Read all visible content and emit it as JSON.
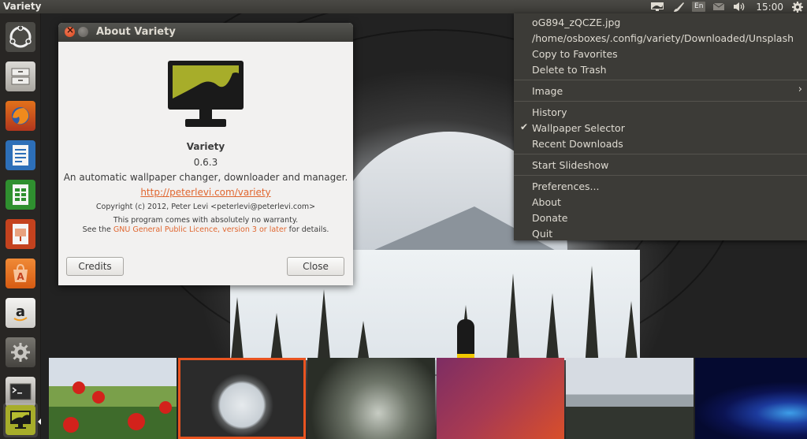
{
  "top_panel": {
    "app_title": "Variety",
    "lang": "En",
    "clock": "15:00",
    "icons": [
      "variety-indicator-icon",
      "brush-icon",
      "keyboard-lang-icon",
      "mail-icon",
      "volume-icon",
      "gear-icon"
    ]
  },
  "launcher": {
    "items": [
      {
        "name": "ubuntu-dash-icon",
        "color": "#3a3a3a"
      },
      {
        "name": "files-icon",
        "color": "#b5b2ac"
      },
      {
        "name": "firefox-icon",
        "color": "#c0491c"
      },
      {
        "name": "writer-icon",
        "color": "#2d6fb8"
      },
      {
        "name": "calc-icon",
        "color": "#2f8f2f"
      },
      {
        "name": "impress-icon",
        "color": "#c4421e"
      },
      {
        "name": "software-center-icon",
        "color": "#e26c1b"
      },
      {
        "name": "amazon-icon",
        "color": "#d8d6d2"
      },
      {
        "name": "system-settings-icon",
        "color": "#5a5955"
      },
      {
        "name": "terminal-icon",
        "color": "#2b2b2b"
      },
      {
        "name": "variety-icon",
        "color": "#a7ad2a"
      }
    ]
  },
  "about": {
    "title": "About Variety",
    "app_name": "Variety",
    "version": "0.6.3",
    "description": "An automatic wallpaper changer, downloader and manager.",
    "link": "http://peterlevi.com/variety",
    "copyright": "Copyright (c) 2012, Peter Levi <peterlevi@peterlevi.com>",
    "warranty_line1": "This program comes with absolutely no warranty.",
    "warranty_line2_pre": "See the ",
    "license_link": "GNU General Public Licence, version 3 or later",
    "warranty_line2_post": " for details.",
    "credits_label": "Credits",
    "close_label": "Close",
    "logo_color": "#a7ad2a"
  },
  "menu": {
    "file_name": "oG894_zQCZE.jpg",
    "file_path": "/home/osboxes/.config/variety/Downloaded/Unsplash",
    "copy_to_favorites": "Copy to Favorites",
    "delete_to_trash": "Delete to Trash",
    "image": "Image",
    "history": "History",
    "wallpaper_selector": "Wallpaper Selector",
    "recent_downloads": "Recent Downloads",
    "start_slideshow": "Start Slideshow",
    "preferences": "Preferences...",
    "about": "About",
    "donate": "Donate",
    "quit": "Quit",
    "check_glyph": "✔",
    "arrow_glyph": "›"
  },
  "colors": {
    "accent": "#e95420",
    "link": "#e0662f",
    "menu_bg": "#3c3b37"
  }
}
